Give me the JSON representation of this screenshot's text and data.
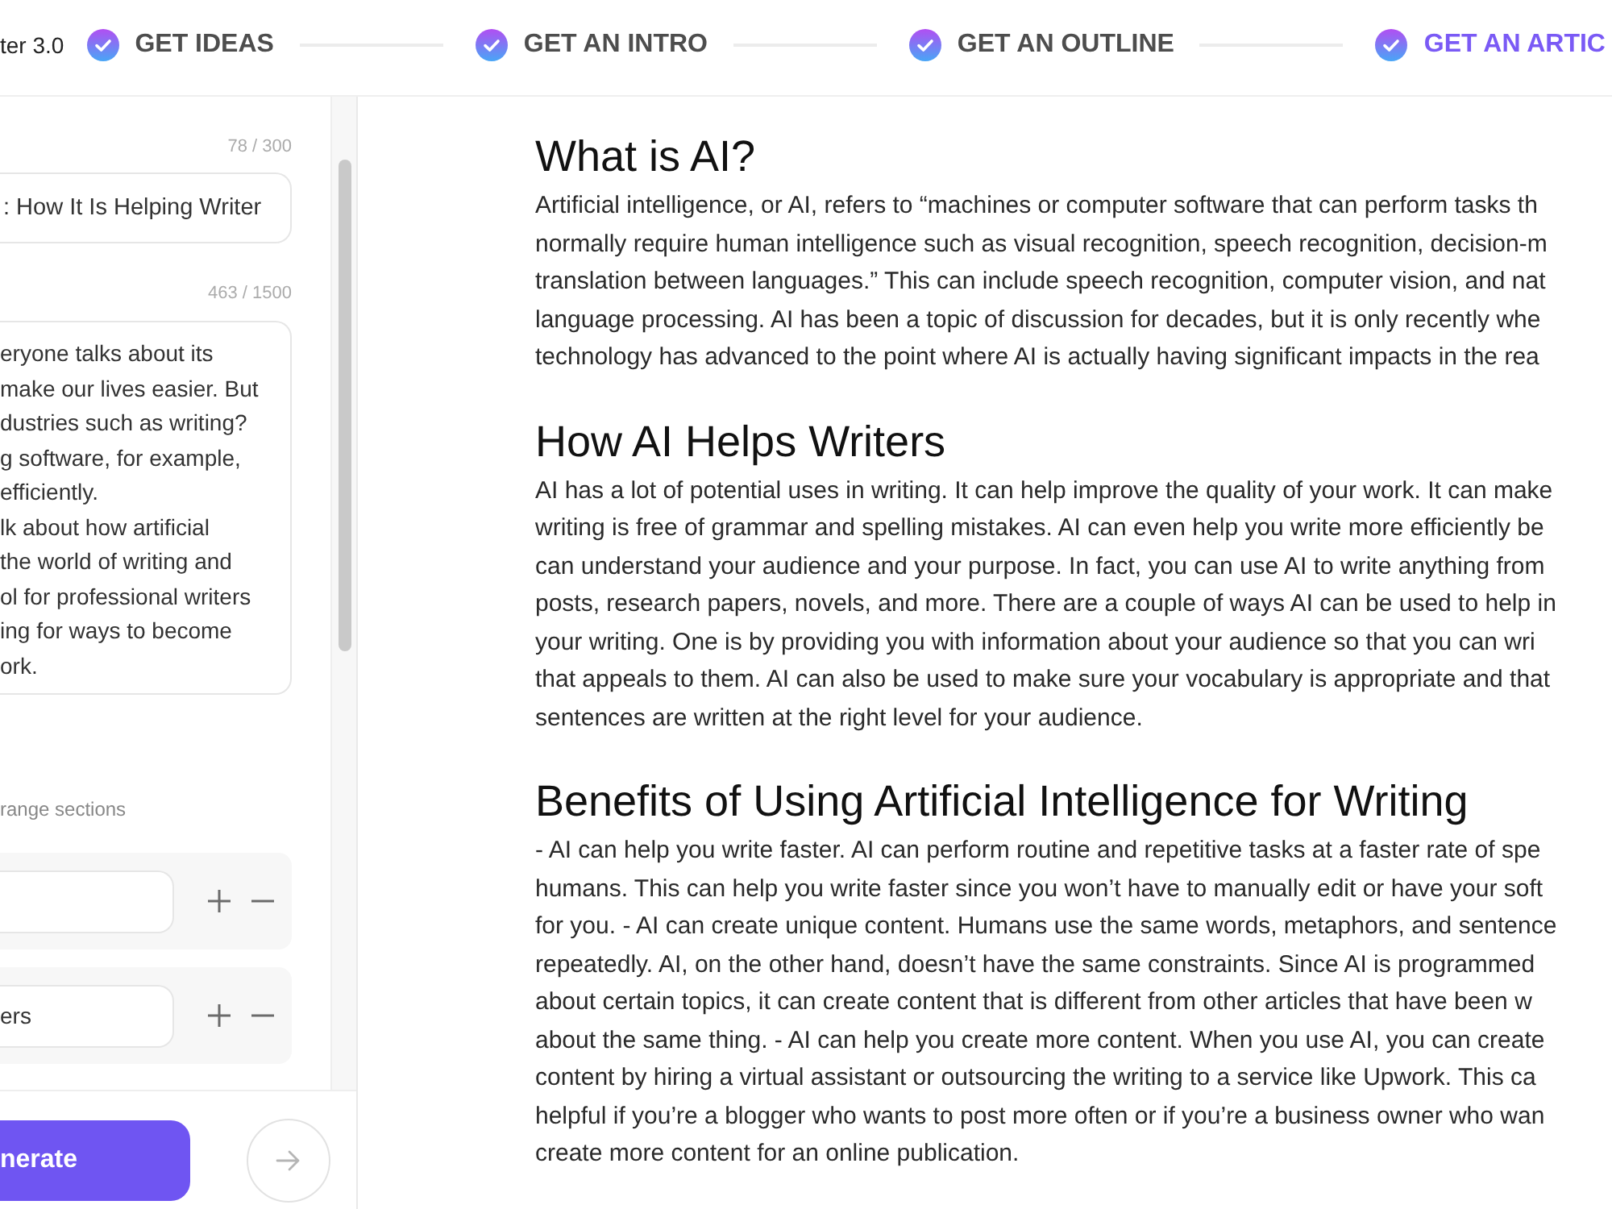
{
  "header": {
    "brand": "ter 3.0",
    "steps": [
      {
        "label": "GET IDEAS",
        "done": true,
        "selected": false
      },
      {
        "label": "GET AN INTRO",
        "done": true,
        "selected": false
      },
      {
        "label": "GET AN OUTLINE",
        "done": true,
        "selected": false
      },
      {
        "label": "GET AN ARTIC",
        "done": true,
        "selected": true
      }
    ]
  },
  "sidebar": {
    "title_field": {
      "counter": "78 / 300",
      "value": ": How It Is Helping Writer"
    },
    "intro_field": {
      "counter": "463 / 1500",
      "lines": [
        "eryone talks about its",
        "make our lives easier. But",
        "dustries such as writing?",
        "g software, for example,",
        "efficiently.",
        "lk about how artificial",
        "the world of writing and",
        "ol for professional writers",
        "ing for ways to become",
        "ork."
      ]
    },
    "sections_hint": "range sections",
    "sections": [
      {
        "kind": "empty"
      },
      {
        "kind": "filled",
        "value": "ers"
      }
    ],
    "generate_button": "nerate"
  },
  "article": {
    "sections": [
      {
        "heading": "What is AI?",
        "lines": [
          "Artificial intelligence, or AI, refers to “machines or computer software that can perform tasks th",
          "normally require human intelligence such as visual recognition, speech recognition, decision-m",
          "translation between languages.” This can include speech recognition, computer vision, and nat",
          "language processing. AI has been a topic of discussion for decades, but it is only recently whe",
          "technology has advanced to the point where AI is actually having significant impacts in the rea"
        ]
      },
      {
        "heading": "How AI Helps Writers",
        "lines": [
          "AI has a lot of potential uses in writing. It can help improve the quality of your work. It can make",
          "writing is free of grammar and spelling mistakes. AI can even help you write more efficiently be",
          "can understand your audience and your purpose. In fact, you can use AI to write anything from",
          "posts, research papers, novels, and more. There are a couple of ways AI can be used to help in",
          "your writing. One is by providing you with information about your audience so that you can wri",
          "that appeals to them. AI can also be used to make sure your vocabulary is appropriate and that",
          "sentences are written at the right level for your audience."
        ]
      },
      {
        "heading": "Benefits of Using Artificial Intelligence for Writing",
        "lines": [
          "- AI can help you write faster. AI can perform routine and repetitive tasks at a faster rate of spe",
          "humans. This can help you write faster since you won’t have to manually edit or have your soft",
          "for you. - AI can create unique content. Humans use the same words, metaphors, and sentence",
          "repeatedly. AI, on the other hand, doesn’t have the same constraints. Since AI is programmed",
          "about certain topics, it can create content that is different from other articles that have been w",
          "about the same thing. - AI can help you create more content. When you use AI, you can create",
          "content by hiring a virtual assistant or outsourcing the writing to a service like Upwork. This ca",
          "helpful if you’re a blogger who wants to post more often or if you’re a business owner who wan",
          "create more content for an online publication."
        ]
      }
    ]
  }
}
